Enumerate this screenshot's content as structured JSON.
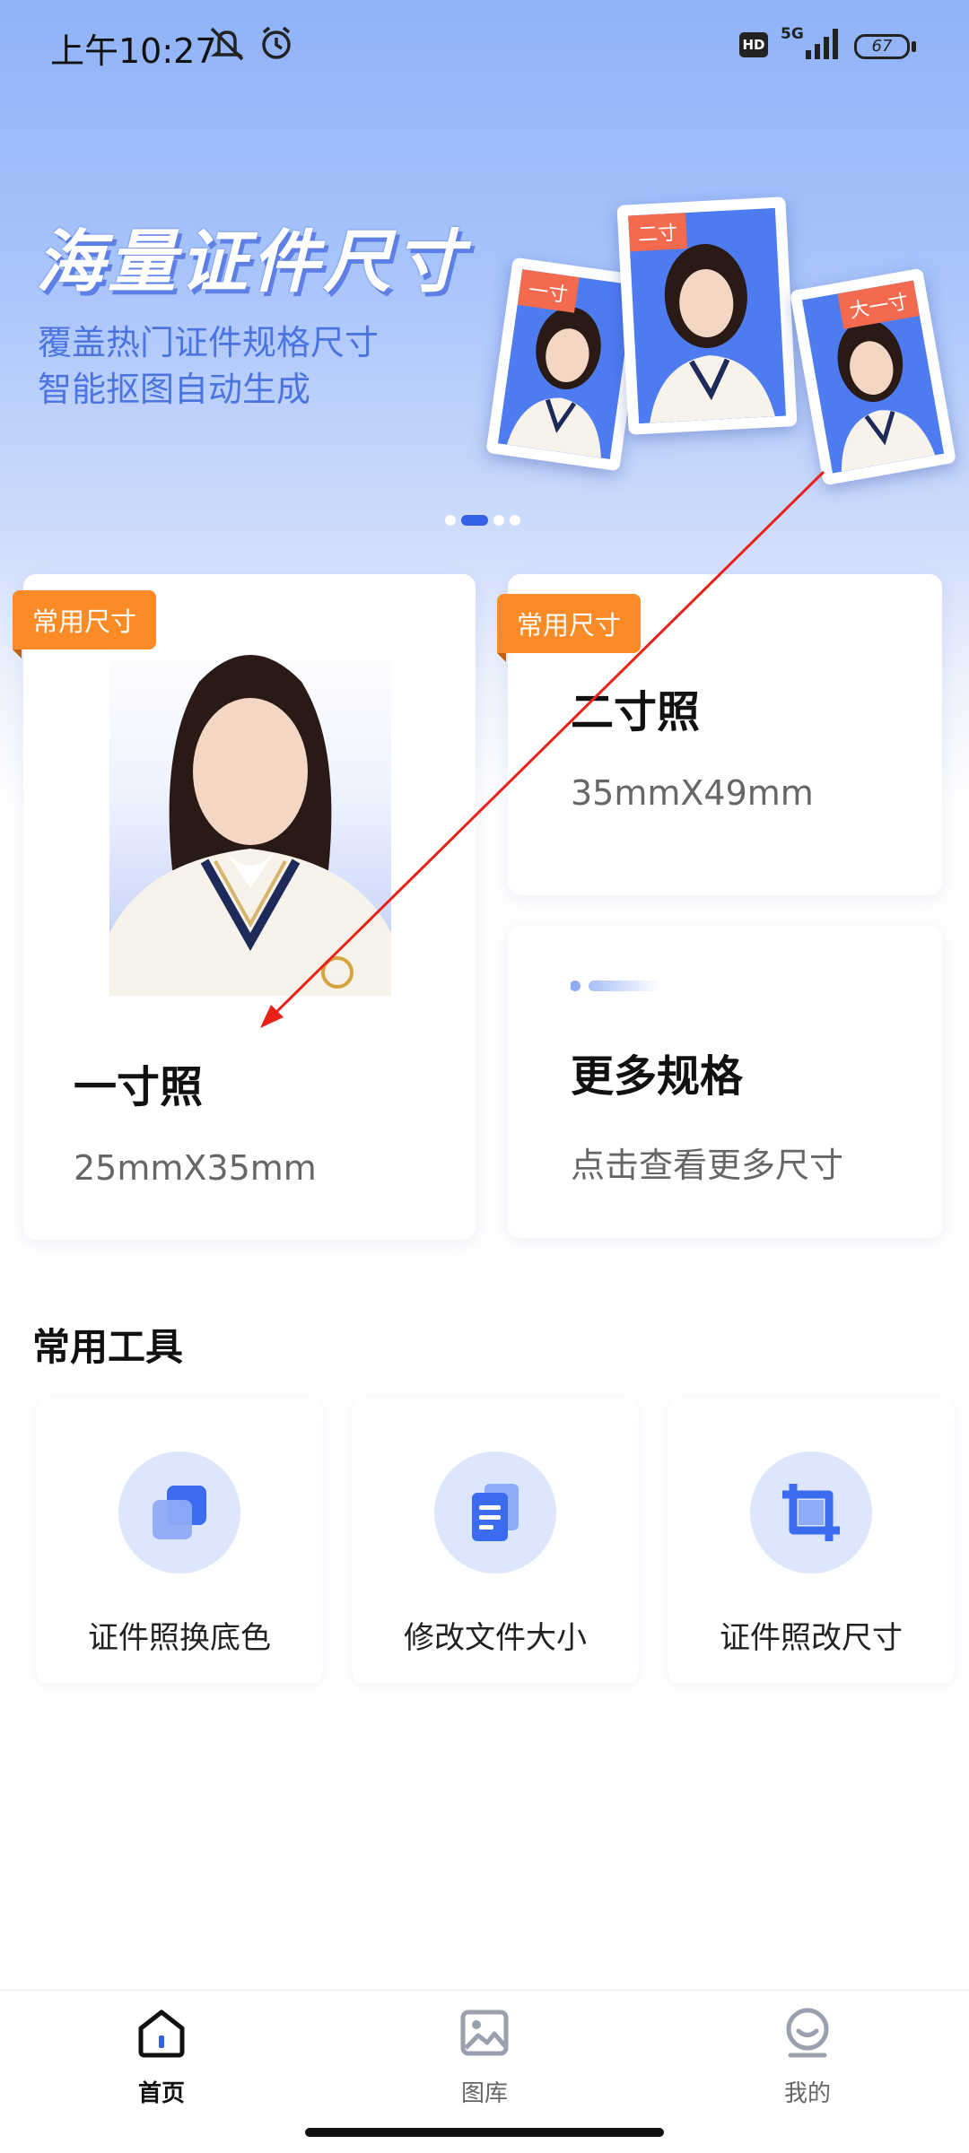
{
  "status_bar": {
    "time": "上午10:27",
    "network": "5G",
    "hd": "HD",
    "battery": "67",
    "icons": [
      "mute-icon",
      "alarm-icon",
      "signal-icon",
      "battery-icon"
    ]
  },
  "banner": {
    "title": "海量证件尺寸",
    "subtitle_line1": "覆盖热门证件规格尺寸",
    "subtitle_line2": "智能抠图自动生成",
    "photo_tags": [
      "一寸",
      "二寸",
      "大一寸"
    ],
    "carousel": {
      "count": 4,
      "active_index": 1
    }
  },
  "cards": {
    "one_inch": {
      "badge": "常用尺寸",
      "title": "一寸照",
      "size": "25mmX35mm"
    },
    "two_inch": {
      "badge": "常用尺寸",
      "title": "二寸照",
      "size": "35mmX49mm"
    },
    "more": {
      "title": "更多规格",
      "subtitle": "点击查看更多尺寸"
    }
  },
  "tools": {
    "section_title": "常用工具",
    "items": [
      {
        "label": "证件照换底色",
        "icon": "layers-icon"
      },
      {
        "label": "修改文件大小",
        "icon": "document-icon"
      },
      {
        "label": "证件照改尺寸",
        "icon": "crop-icon"
      }
    ]
  },
  "nav": {
    "items": [
      {
        "label": "首页",
        "icon": "home-icon",
        "active": true
      },
      {
        "label": "图库",
        "icon": "gallery-icon",
        "active": false
      },
      {
        "label": "我的",
        "icon": "profile-icon",
        "active": false
      }
    ]
  },
  "colors": {
    "accent": "#3461e6",
    "badge": "#fb8b26",
    "annotation_arrow": "#e8221b"
  }
}
